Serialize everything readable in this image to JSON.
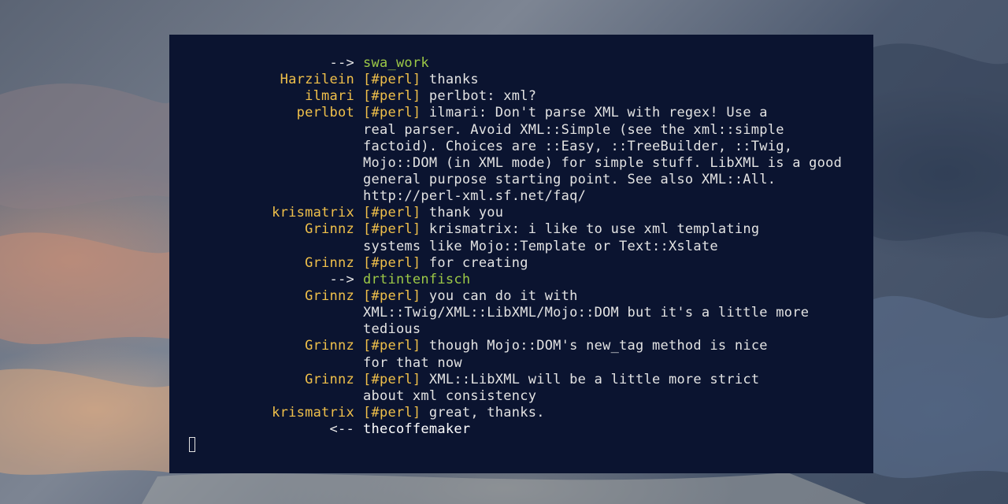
{
  "terminal": {
    "lines": [
      {
        "nick": "-->",
        "channel": "",
        "text": "swa_work",
        "kind": "join"
      },
      {
        "nick": "Harzilein",
        "channel": "[#perl]",
        "text": "thanks",
        "kind": "msg"
      },
      {
        "nick": "ilmari",
        "channel": "[#perl]",
        "text": "perlbot: xml?",
        "kind": "msg"
      },
      {
        "nick": "perlbot",
        "channel": "[#perl]",
        "text": "ilmari: Don't parse XML with regex! Use a",
        "kind": "msg"
      },
      {
        "nick": "",
        "channel": "",
        "text": "real parser. Avoid XML::Simple (see the xml::simple",
        "kind": "cont"
      },
      {
        "nick": "",
        "channel": "",
        "text": "factoid). Choices are ::Easy, ::TreeBuilder, ::Twig,",
        "kind": "cont"
      },
      {
        "nick": "",
        "channel": "",
        "text": "Mojo::DOM (in XML mode) for simple stuff. LibXML is a good",
        "kind": "cont"
      },
      {
        "nick": "",
        "channel": "",
        "text": "general purpose starting point. See also XML::All.",
        "kind": "cont"
      },
      {
        "nick": "",
        "channel": "",
        "text": "http://perl-xml.sf.net/faq/",
        "kind": "cont"
      },
      {
        "nick": "krismatrix",
        "channel": "[#perl]",
        "text": "thank you",
        "kind": "msg"
      },
      {
        "nick": "Grinnz",
        "channel": "[#perl]",
        "text": "krismatrix: i like to use xml templating",
        "kind": "msg"
      },
      {
        "nick": "",
        "channel": "",
        "text": "systems like Mojo::Template or Text::Xslate",
        "kind": "cont"
      },
      {
        "nick": "Grinnz",
        "channel": "[#perl]",
        "text": "for creating",
        "kind": "msg"
      },
      {
        "nick": "-->",
        "channel": "",
        "text": "drtintenfisch",
        "kind": "join"
      },
      {
        "nick": "Grinnz",
        "channel": "[#perl]",
        "text": "you can do it with",
        "kind": "msg"
      },
      {
        "nick": "",
        "channel": "",
        "text": "XML::Twig/XML::LibXML/Mojo::DOM but it's a little more",
        "kind": "cont"
      },
      {
        "nick": "",
        "channel": "",
        "text": "tedious",
        "kind": "cont"
      },
      {
        "nick": "Grinnz",
        "channel": "[#perl]",
        "text": "though Mojo::DOM's new_tag method is nice",
        "kind": "msg"
      },
      {
        "nick": "",
        "channel": "",
        "text": "for that now",
        "kind": "cont"
      },
      {
        "nick": "Grinnz",
        "channel": "[#perl]",
        "text": "XML::LibXML will be a little more strict",
        "kind": "msg"
      },
      {
        "nick": "",
        "channel": "",
        "text": "about xml consistency",
        "kind": "cont"
      },
      {
        "nick": "krismatrix",
        "channel": "[#perl]",
        "text": "great, thanks.",
        "kind": "msg"
      },
      {
        "nick": "<--",
        "channel": "",
        "text": "thecoffemaker",
        "kind": "part"
      }
    ],
    "input_value": ""
  },
  "colors": {
    "terminal_bg": "#0b1430",
    "nick": "#f0c04a",
    "channel": "#f0c04a",
    "text": "#e3e3e3",
    "join": "#9cc846"
  }
}
